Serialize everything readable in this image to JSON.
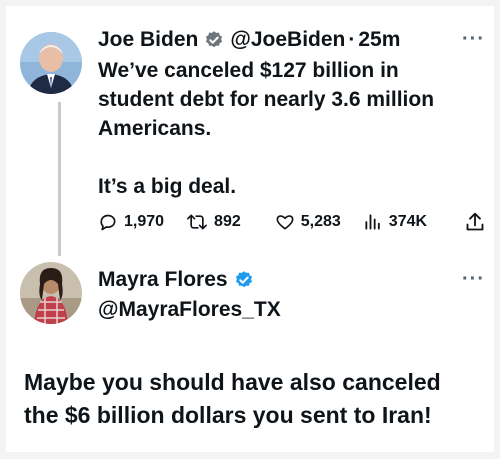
{
  "tweet1": {
    "name": "Joe Biden",
    "handle": "@JoeBiden",
    "separator": "·",
    "time": "25m",
    "text": "We’ve canceled $127 billion in\nstudent debt for nearly 3.6 million\nAmericans.\n\nIt’s a big deal.",
    "stats": {
      "replies": "1,970",
      "retweets": "892",
      "likes": "5,283",
      "views": "374K"
    },
    "more_icon": "more-horizontal-icon",
    "verified_color": "#1d9bf0"
  },
  "tweet2": {
    "name": "Mayra Flores",
    "handle": "@MayraFlores_TX",
    "text": "Maybe you should have also canceled\nthe $6 billion dollars you sent to Iran!",
    "more_icon": "more-horizontal-icon",
    "verified_color": "#1d9bf0"
  },
  "icons": [
    "reply-icon",
    "retweet-icon",
    "like-icon",
    "views-icon",
    "share-icon",
    "verified-badge-icon"
  ]
}
